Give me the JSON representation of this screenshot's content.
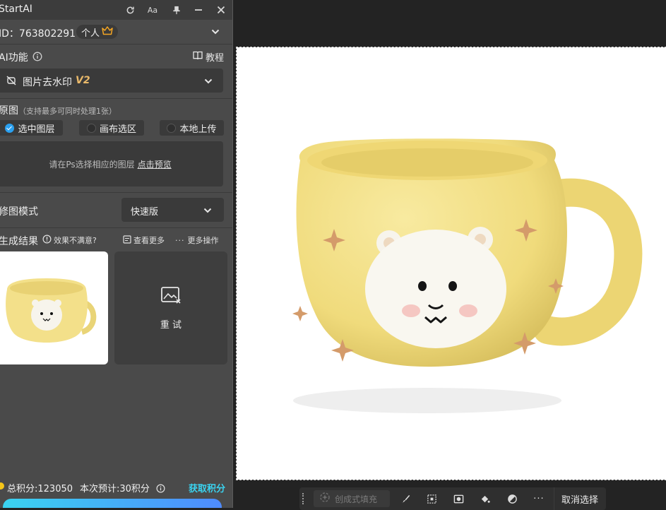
{
  "app": {
    "title": "StartAI",
    "title_icons": [
      "refresh-icon",
      "font-size-icon",
      "pin-icon",
      "minimize-icon",
      "close-icon"
    ],
    "font_btn_label": "Aa"
  },
  "account": {
    "id_text": "ID：763802291",
    "plan_label": "个人",
    "plan_icon": "crown-icon",
    "expand_icon": "chevron-down-icon"
  },
  "ai_section": {
    "label": "AI功能",
    "info_icon": "info-icon",
    "tutorial_label": "教程",
    "tutorial_icon": "book-icon"
  },
  "feature_select": {
    "label": "图片去水印",
    "version": "V2",
    "icon": "watermark-off-icon",
    "dropdown_icon": "chevron-down-icon"
  },
  "source": {
    "label": "原图",
    "note": "（支持最多可同时处理1张）",
    "options": [
      {
        "label": "选中图层",
        "selected": true
      },
      {
        "label": "画布选区",
        "selected": false
      },
      {
        "label": "本地上传",
        "selected": false
      }
    ],
    "placeholder": "请在Ps选择相应的图层",
    "preview_link": "点击预览"
  },
  "mode": {
    "label": "修图模式",
    "selected": "快速版"
  },
  "result": {
    "label": "生成结果",
    "unsatisfied": "效果不满意?",
    "view_more": "查看更多",
    "more_ops": "更多操作",
    "retry_label": "重 试"
  },
  "points": {
    "total": "总积分:123050",
    "estimate": "本次预计:30积分",
    "get_points": "获取积分"
  },
  "toolbar": {
    "generative_fill": "创成式填充",
    "deselect": "取消选择",
    "tools": [
      "brush-icon",
      "transform-select-icon",
      "mask-icon",
      "paint-bucket-icon",
      "adjust-icon",
      "more-icon"
    ]
  },
  "colors": {
    "accent": "#2aa0f0",
    "link": "#3ad3f0",
    "mug": "#f3e08a",
    "panel_bg": "#4a4a4a"
  }
}
